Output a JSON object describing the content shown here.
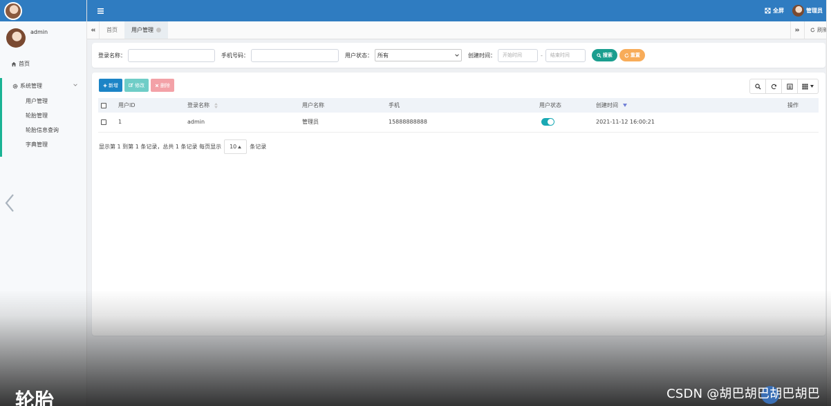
{
  "topbar": {
    "fullscreen_label": "全屏",
    "user_label": "管理员"
  },
  "sidebar": {
    "username": "admin",
    "home_label": "首页",
    "group_label": "系统管理",
    "items": [
      {
        "label": "用户管理"
      },
      {
        "label": "轮胎管理"
      },
      {
        "label": "轮胎信息查询"
      },
      {
        "label": "字典管理"
      }
    ]
  },
  "tabs": {
    "items": [
      {
        "label": "首页",
        "active": false
      },
      {
        "label": "用户管理",
        "active": true
      }
    ],
    "refresh_label": "刷新"
  },
  "search": {
    "login_name_label": "登录名称：",
    "phone_label": "手机号码：",
    "status_label": "用户状态：",
    "status_value": "所有",
    "created_label": "创建时间：",
    "start_placeholder": "开始时间",
    "dash": "-",
    "end_placeholder": "结束时间",
    "search_button": "搜索",
    "reset_button": "重置"
  },
  "toolbar": {
    "add_label": "新增",
    "edit_label": "修改",
    "delete_label": "删除"
  },
  "table": {
    "columns": [
      "用户ID",
      "登录名称",
      "用户名称",
      "手机",
      "用户状态",
      "创建时间",
      "操作"
    ],
    "rows": [
      {
        "id": "1",
        "login_name": "admin",
        "user_name": "管理员",
        "phone": "15888888888",
        "status_on": true,
        "created": "2021-11-12 16:00:21"
      }
    ]
  },
  "pagination": {
    "summary": "显示第 1 到第 1 条记录，总共 1 条记录 每页显示",
    "page_size": "10",
    "suffix": "条记录"
  },
  "overlay": {
    "watermark": "CSDN @胡巴胡巴胡巴胡巴",
    "bottom_text": "轮胎"
  },
  "colors": {
    "brand_blue": "#2f7cc1",
    "accent_green": "#1ab394",
    "search_teal": "#1a9e8f",
    "reset_orange": "#f8ac59",
    "add_blue": "#1c84c6",
    "edit_teal": "#6fcdc7",
    "delete_red": "#f3a1a7",
    "toggle_on": "#1aa9b4"
  }
}
